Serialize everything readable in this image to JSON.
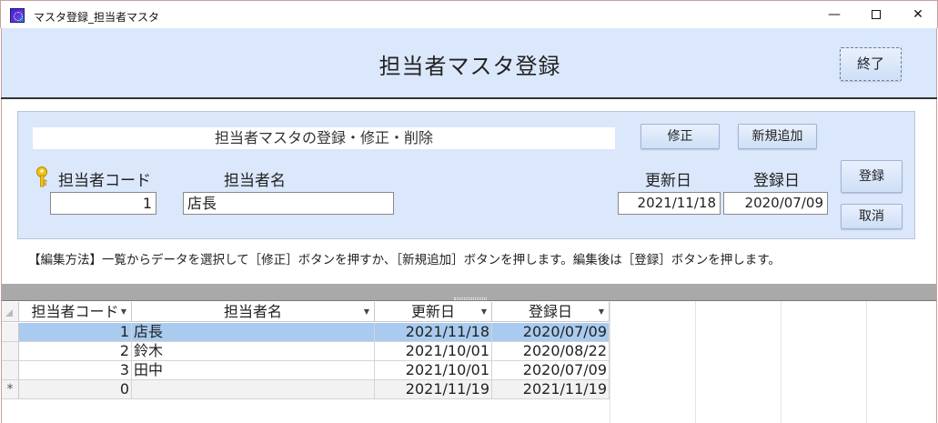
{
  "window": {
    "title": "マスタ登録_担当者マスタ",
    "minimize": "—",
    "close": "✕"
  },
  "header": {
    "title": "担当者マスタ登録",
    "exit_button": "終了"
  },
  "panel": {
    "caption": "担当者マスタの登録・修正・削除",
    "edit_button": "修正",
    "new_button": "新規追加",
    "save_button": "登録",
    "cancel_button": "取消",
    "labels": {
      "code": "担当者コード",
      "name": "担当者名",
      "updated": "更新日",
      "registered": "登録日"
    },
    "fields": {
      "code": "1",
      "name": "店長",
      "updated": "2021/11/18",
      "registered": "2020/07/09"
    }
  },
  "instruction": "【編集方法】一覧からデータを選択して［修正］ボタンを押すか、［新規追加］ボタンを押します。編集後は［登録］ボタンを押します。",
  "datasheet": {
    "columns": [
      "担当者コード",
      "担当者名",
      "更新日",
      "登録日"
    ],
    "rows": [
      {
        "selector": "",
        "code": "1",
        "name": "店長",
        "updated": "2021/11/18",
        "registered": "2020/07/09"
      },
      {
        "selector": "",
        "code": "2",
        "name": "鈴木",
        "updated": "2021/10/01",
        "registered": "2020/08/22"
      },
      {
        "selector": "",
        "code": "3",
        "name": "田中",
        "updated": "2021/10/01",
        "registered": "2020/07/09"
      },
      {
        "selector": "*",
        "code": "0",
        "name": "",
        "updated": "2021/11/19",
        "registered": "2021/11/19"
      }
    ]
  },
  "colors": {
    "header_bg": "#dbe7fb",
    "selection": "#a9cbef",
    "splitter": "#a9a9a9"
  },
  "icons": [
    "app-icon",
    "key-icon",
    "dropdown-arrow-icon"
  ]
}
